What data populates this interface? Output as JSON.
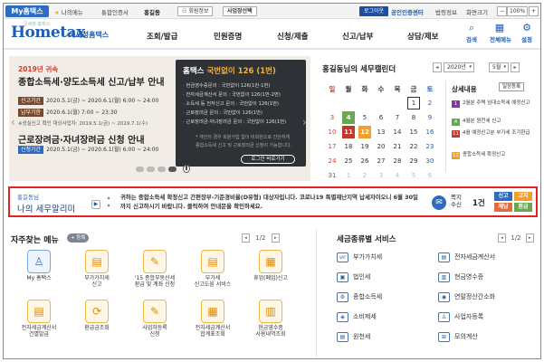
{
  "topbar": {
    "my_tab": "My홈택스",
    "my_menu": "나의메뉴",
    "integrated_cert": "통합인증서",
    "user_name": "홍길동",
    "member_info": "회원정보",
    "business_select": "사업장선택",
    "logout": "로그아웃",
    "public_cert_center": "공인인증센터",
    "legal_info": "법령정보",
    "screen_size": "화면크기",
    "zoom_minus": "−",
    "zoom_level": "100%",
    "zoom_plus": "+"
  },
  "header": {
    "logo_text": "Hometax",
    "logo_sub": "국세청홈택스",
    "logo_tagline": "국세청 홈택스",
    "nav": [
      "조회/발급",
      "민원증명",
      "신청/제출",
      "신고/납부",
      "상담/제보"
    ],
    "icons": [
      {
        "name": "search",
        "label": "검색"
      },
      {
        "name": "all-menu",
        "label": "전체메뉴"
      },
      {
        "name": "settings",
        "label": "설정"
      }
    ]
  },
  "banner": {
    "year_tag": "2019년 귀속",
    "title1": "종합소득세·양도소득세 신고/납부 안내",
    "rows": [
      {
        "badge": "신고기간",
        "text": "2020.5.1(금) ~ 2020.6.1(월) 6:00 ~ 24:00"
      },
      {
        "badge": "납부기한",
        "text": "2020.6.1(월) 7:00 ~ 23:30"
      }
    ],
    "note": "※성실신고 확인 대상사업자: 2019.5.1(금) ~ 2019.7.1(수)",
    "title2": "근로장려금·자녀장려금 신청 안내",
    "row3": {
      "badge": "신청기간",
      "text": "2020.5.1(금) ~ 2020.6.1(월) 6:00 ~ 24:00"
    },
    "card": {
      "title_prefix": "홈택스",
      "title_accent": "국번없이 126 (1번)",
      "lines": [
        "· 현금영수증문의 : 국번없이 126(1번-1번)",
        "· 전자세금계산서 문의 : 국번없이 126(1번-2번)",
        "· 소득세 등 전자신고 문의 : 국번없이 126(1번)",
        "· 근로장려금 문의 : 국번없이 126(1번)",
        "· 근로장려금·자녀장려금 문의 : 국번없이 126(1번)"
      ],
      "note1": "* 개인의 경우 회원가입 없이 비회원으로 간단하게",
      "note2": "종합소득세 신고 및 근로장려금 신청이 가능합니다.",
      "login_btn": "로그인 바로가기"
    },
    "pages_total": 4,
    "page_current": 4
  },
  "calendar": {
    "title": "홍길동님의 세무캘린더",
    "year": "2020년",
    "month": "5월",
    "view_btn": "일정등록",
    "weekdays": [
      "일",
      "월",
      "화",
      "수",
      "목",
      "금",
      "토"
    ],
    "days": [
      [
        null,
        null,
        null,
        null,
        null,
        "1",
        "2"
      ],
      [
        "3",
        "4",
        "5",
        "6",
        "7",
        "8",
        "9"
      ],
      [
        "10",
        "11",
        "12",
        "13",
        "14",
        "15",
        "16"
      ],
      [
        "17",
        "18",
        "19",
        "20",
        "21",
        "22",
        "23"
      ],
      [
        "24",
        "25",
        "26",
        "27",
        "28",
        "29",
        "30"
      ],
      [
        "31",
        "1",
        "2",
        "3",
        "4",
        "5",
        "6"
      ]
    ],
    "marked": {
      "4": "#6aa84f",
      "11": "#c0392b",
      "12": "#f0a030",
      "1": "#7d3c98"
    },
    "today": "1",
    "detail_title": "상세내용",
    "items": [
      {
        "num": "1",
        "color": "#7d3c98",
        "text": "2월분 주택 임대소득세 예정신고"
      },
      {
        "num": "4",
        "color": "#6aa84f",
        "text": "4월분 원천세 신고"
      },
      {
        "num": "11",
        "color": "#c0392b",
        "text": "4월 예정신고분 부가세 조기환급"
      },
      {
        "num": "12",
        "color": "#f0a030",
        "text": "종합소득세 확정신고"
      }
    ]
  },
  "notice": {
    "user": "홍길동님",
    "title": "나의 세무알리미",
    "message": "귀하는 종합소득세 확정신고 간편장부-기준경비율(D유형) 대상자입니다. 코로나19 특별재난지역 납세자이오니 6월 30일까지 신고하시기 바랍니다. 클릭하여 안내문을 확인하세요.",
    "badge_label_1": "쪽지",
    "badge_label_2": "수신",
    "count": "1건",
    "tags": [
      {
        "label": "신고",
        "color": "#2d6cc0"
      },
      {
        "label": "고지",
        "color": "#f0a030"
      },
      {
        "label": "체납",
        "color": "#e36c3b"
      },
      {
        "label": "환급",
        "color": "#6aa84f"
      }
    ]
  },
  "quick_menu": {
    "title": "자주찾는 메뉴",
    "add_btn": "+ 등록",
    "pager": "1/2",
    "items": [
      {
        "icon": "person-icon",
        "glyph": "♙",
        "label1": "My 홈택스",
        "label2": "",
        "blue": true
      },
      {
        "icon": "vat-icon",
        "glyph": "▤",
        "label1": "부가가치세",
        "label2": "신고",
        "blue": false
      },
      {
        "icon": "refund-icon",
        "glyph": "✎",
        "label1": "'15 종합부동산세",
        "label2": "환급 및 계좌 신청",
        "blue": false
      },
      {
        "icon": "vat-return-icon",
        "glyph": "▤",
        "label1": "부가세",
        "label2": "신고도움 서비스",
        "blue": false
      },
      {
        "icon": "closure-icon",
        "glyph": "▦",
        "label1": "휴업(폐업)신고",
        "label2": "",
        "blue": false
      },
      {
        "icon": "invoice-icon",
        "glyph": "▤",
        "label1": "전자세금계산서",
        "label2": "건별발급",
        "blue": false
      },
      {
        "icon": "refund-lookup-icon",
        "glyph": "⟳",
        "label1": "환급금조회",
        "label2": "",
        "blue": false
      },
      {
        "icon": "biz-register-icon",
        "glyph": "✎",
        "label1": "사업자등록",
        "label2": "신청",
        "blue": false
      },
      {
        "icon": "invoice-sum-icon",
        "glyph": "▦",
        "label1": "전자세금계산서",
        "label2": "합계표조회",
        "blue": false
      },
      {
        "icon": "cash-receipt-icon",
        "glyph": "▥",
        "label1": "현금영수증",
        "label2": "사용내역조회",
        "blue": false
      }
    ]
  },
  "tax_services": {
    "title": "세금종류별 서비스",
    "pager": "1/2",
    "items": [
      {
        "icon": "vat-icon",
        "glyph": "VAT",
        "label": "부가가치세"
      },
      {
        "icon": "e-invoice-icon",
        "glyph": "▤",
        "label": "전자세금계산서"
      },
      {
        "icon": "corp-tax-icon",
        "glyph": "▣",
        "label": "법인세"
      },
      {
        "icon": "cash-receipt-icon",
        "glyph": "▥",
        "label": "현금영수증"
      },
      {
        "icon": "income-tax-icon",
        "glyph": "⚙",
        "label": "종합소득세"
      },
      {
        "icon": "year-end-icon",
        "glyph": "◉",
        "label": "연말정산간소화"
      },
      {
        "icon": "consumption-tax-icon",
        "glyph": "◈",
        "label": "소비제세"
      },
      {
        "icon": "business-icon",
        "glyph": "♙",
        "label": "사업자등록"
      },
      {
        "icon": "withholding-icon",
        "glyph": "▤",
        "label": "원천세"
      },
      {
        "icon": "calculator-icon",
        "glyph": "⊞",
        "label": "모의계산"
      }
    ]
  }
}
